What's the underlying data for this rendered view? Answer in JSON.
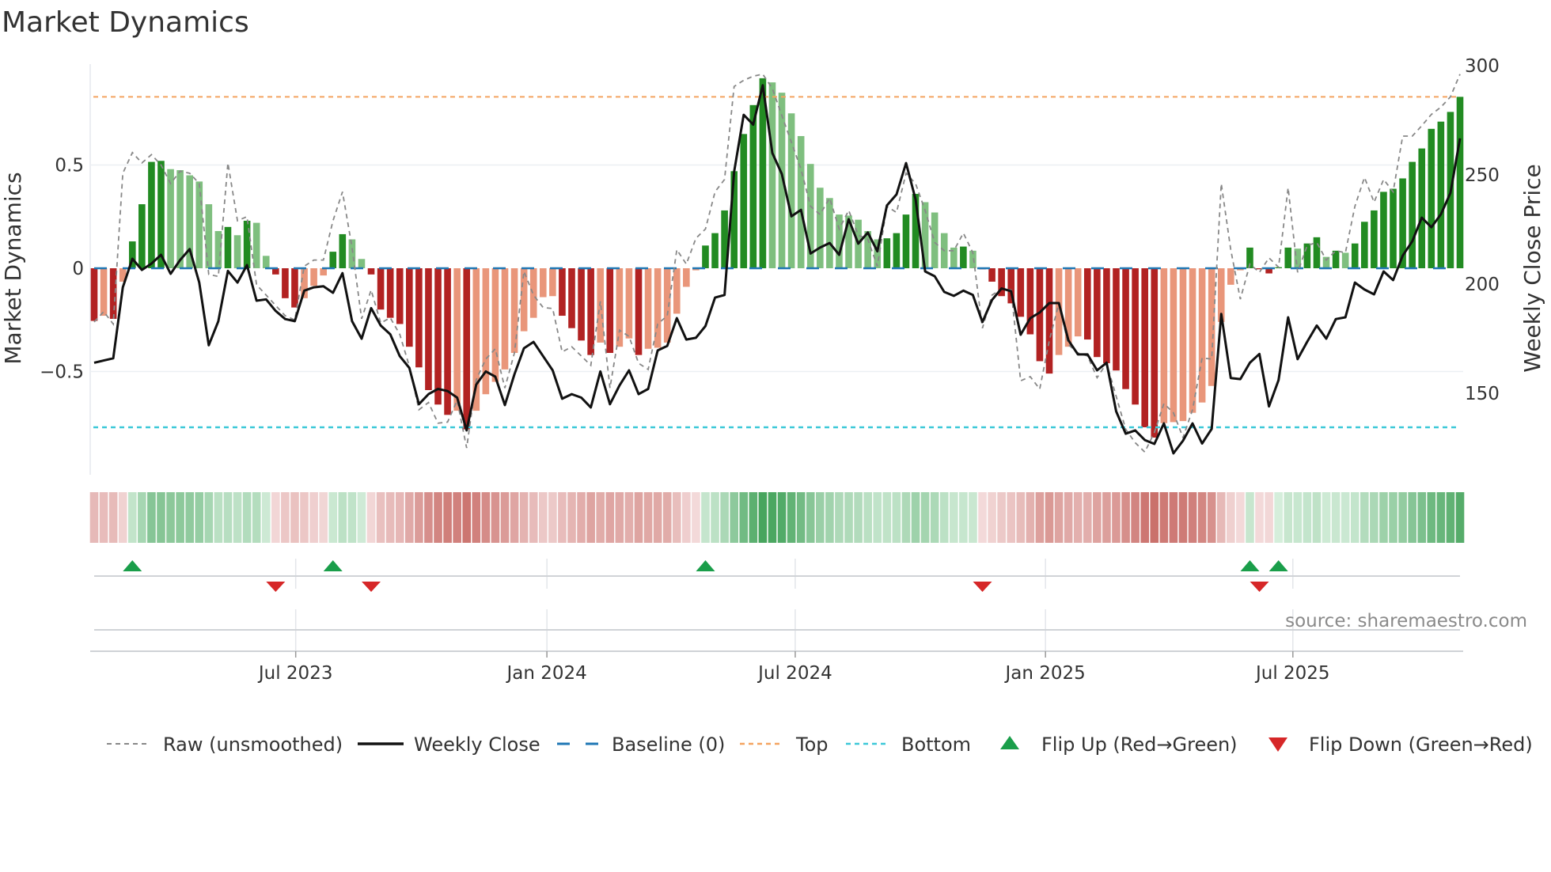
{
  "title": "Market Dynamics",
  "source": "source: sharemaestro.com",
  "colors": {
    "rising_green": "#228b22",
    "falling_green": "#7fbf7f",
    "falling_red": "#b22222",
    "rising_red": "#e9967a",
    "close": "#111111",
    "raw": "#888888",
    "baseline": "#1f77b4",
    "top": "#f4a460",
    "bottom": "#3cc8d8",
    "flip_up": "#1a9e4a",
    "flip_down": "#d62728"
  },
  "chart_data": {
    "type": "bar",
    "title": "Market Dynamics",
    "ylabel": "Market Dynamics",
    "y2label": "Weekly Close Price",
    "ylim": [
      -0.97,
      0.97
    ],
    "y2lim": [
      116,
      300
    ],
    "y_ticks": [
      {
        "value": 0.5,
        "label": "0.5"
      },
      {
        "value": 0,
        "label": "0"
      },
      {
        "value": -0.5,
        "label": "−0.5"
      }
    ],
    "y2_ticks": [
      {
        "value": 300,
        "label": "300"
      },
      {
        "value": 250,
        "label": "250"
      },
      {
        "value": 200,
        "label": "200"
      },
      {
        "value": 150,
        "label": "150"
      }
    ],
    "x_unit": "week index",
    "x_ticks": [
      {
        "index": 21.1,
        "label": "Jul 2023"
      },
      {
        "index": 47.4,
        "label": "Jan 2024"
      },
      {
        "index": 73.4,
        "label": "Jul 2024"
      },
      {
        "index": 99.6,
        "label": "Jan 2025"
      },
      {
        "index": 125.5,
        "label": "Jul 2025"
      }
    ],
    "grid": true,
    "legend_position": "bottom",
    "thresholds": {
      "baseline": 0,
      "top": 0.83,
      "bottom": -0.77
    },
    "series": [
      {
        "name": "Market Dynamics",
        "type": "bar",
        "values": [
          -0.255,
          -0.23,
          -0.245,
          -0.065,
          0.13,
          0.31,
          0.515,
          0.52,
          0.48,
          0.475,
          0.45,
          0.42,
          0.31,
          0.18,
          0.2,
          0.16,
          0.23,
          0.22,
          0.06,
          -0.03,
          -0.145,
          -0.19,
          -0.145,
          -0.085,
          -0.035,
          0.08,
          0.165,
          0.14,
          0.045,
          -0.03,
          -0.2,
          -0.24,
          -0.27,
          -0.38,
          -0.48,
          -0.59,
          -0.66,
          -0.71,
          -0.69,
          -0.78,
          -0.69,
          -0.61,
          -0.55,
          -0.49,
          -0.41,
          -0.305,
          -0.24,
          -0.14,
          -0.135,
          -0.23,
          -0.29,
          -0.35,
          -0.42,
          -0.36,
          -0.41,
          -0.38,
          -0.34,
          -0.42,
          -0.39,
          -0.385,
          -0.36,
          -0.22,
          -0.09,
          -0.01,
          0.11,
          0.17,
          0.28,
          0.47,
          0.65,
          0.79,
          0.92,
          0.9,
          0.85,
          0.75,
          0.64,
          0.505,
          0.39,
          0.34,
          0.26,
          0.255,
          0.235,
          0.18,
          0.14,
          0.145,
          0.17,
          0.26,
          0.36,
          0.32,
          0.27,
          0.17,
          0.1,
          0.105,
          0.085,
          -0.005,
          -0.065,
          -0.135,
          -0.17,
          -0.235,
          -0.32,
          -0.45,
          -0.51,
          -0.42,
          -0.38,
          -0.33,
          -0.345,
          -0.43,
          -0.46,
          -0.495,
          -0.585,
          -0.66,
          -0.77,
          -0.82,
          -0.75,
          -0.745,
          -0.74,
          -0.7,
          -0.65,
          -0.57,
          -0.26,
          -0.08,
          -0.01,
          0.1,
          -0.005,
          -0.025,
          0.005,
          0.1,
          0.095,
          0.12,
          0.15,
          0.055,
          0.085,
          0.075,
          0.12,
          0.225,
          0.28,
          0.37,
          0.385,
          0.435,
          0.515,
          0.58,
          0.675,
          0.71,
          0.757,
          0.83
        ]
      },
      {
        "name": "Raw (unsmoothed)",
        "type": "line",
        "values": [
          -0.26,
          -0.21,
          -0.27,
          0.46,
          0.56,
          0.51,
          0.55,
          0.5,
          0.41,
          0.47,
          0.46,
          0.41,
          -0.03,
          -0.04,
          0.51,
          0.23,
          0.25,
          -0.08,
          -0.13,
          -0.18,
          -0.23,
          -0.25,
          0.01,
          0.04,
          0.04,
          0.23,
          0.37,
          0.1,
          -0.245,
          -0.105,
          -0.265,
          -0.24,
          -0.32,
          -0.475,
          -0.685,
          -0.65,
          -0.75,
          -0.745,
          -0.64,
          -0.87,
          -0.54,
          -0.44,
          -0.39,
          -0.58,
          -0.41,
          -0.015,
          -0.13,
          -0.19,
          -0.195,
          -0.405,
          -0.38,
          -0.425,
          -0.47,
          -0.16,
          -0.58,
          -0.3,
          -0.33,
          -0.46,
          -0.49,
          -0.27,
          -0.23,
          0.09,
          0.02,
          0.145,
          0.19,
          0.37,
          0.43,
          0.88,
          0.91,
          0.93,
          0.94,
          0.87,
          0.74,
          0.61,
          0.48,
          0.3,
          0.26,
          0.34,
          0.19,
          0.28,
          0.16,
          0.14,
          0.01,
          0.3,
          0.27,
          0.46,
          0.41,
          0.28,
          0.125,
          0.085,
          0.085,
          0.17,
          0.075,
          -0.29,
          -0.13,
          -0.1,
          -0.105,
          -0.545,
          -0.525,
          -0.585,
          -0.35,
          -0.17,
          -0.37,
          -0.41,
          -0.425,
          -0.53,
          -0.46,
          -0.62,
          -0.78,
          -0.845,
          -0.89,
          -0.795,
          -0.655,
          -0.7,
          -0.82,
          -0.685,
          -0.435,
          -0.44,
          0.41,
          0.09,
          -0.15,
          0.02,
          -0.02,
          0.05,
          0.005,
          0.39,
          -0.02,
          0.11,
          0.125,
          0.04,
          0.085,
          0.075,
          0.3,
          0.44,
          0.32,
          0.43,
          0.37,
          0.64,
          0.64,
          0.69,
          0.745,
          0.78,
          0.83,
          0.94
        ]
      },
      {
        "name": "Weekly Close",
        "type": "line",
        "axis": "right",
        "values": [
          164,
          165,
          166,
          198.5,
          211.6,
          206.5,
          209.4,
          213.4,
          204.7,
          211,
          216,
          200.7,
          172,
          183,
          206,
          200.7,
          208.7,
          192.4,
          193,
          187.7,
          184,
          183,
          197,
          198.5,
          199,
          196,
          205,
          183,
          175,
          189,
          181,
          177,
          167,
          161.6,
          145,
          149.6,
          152,
          151,
          148,
          133,
          154,
          160,
          157.6,
          144.6,
          158.7,
          170.6,
          173.5,
          167,
          160.5,
          147.5,
          149.6,
          148,
          143.5,
          160,
          145,
          153.6,
          160.5,
          149.6,
          152,
          169.6,
          171.7,
          184.4,
          174.6,
          175.4,
          180.8,
          193.8,
          195,
          251.4,
          277.5,
          273,
          291,
          260,
          250.4,
          231,
          234,
          214,
          216.7,
          218.8,
          213.4,
          229.7,
          218.5,
          223.6,
          215,
          236,
          241,
          255.4,
          238.8,
          205.8,
          203.6,
          196.4,
          194.6,
          197,
          195,
          182.6,
          192.7,
          198,
          196.7,
          176.8,
          184.4,
          187,
          191.3,
          191.3,
          174.3,
          167.8,
          167.8,
          160.5,
          164,
          141.7,
          131.5,
          133,
          128.6,
          126.8,
          136.2,
          122.5,
          128.3,
          136.2,
          127,
          133.7,
          186.3,
          157,
          156.5,
          164,
          168,
          144,
          156,
          184.8,
          165.6,
          173.6,
          181,
          175,
          184,
          184.8,
          200.7,
          197.5,
          195.3,
          205.8,
          201.8,
          213,
          219.6,
          230.4,
          226,
          232,
          241.7,
          266.7
        ]
      }
    ],
    "flip_up_indices": [
      5,
      26,
      65,
      122,
      125
    ],
    "flip_down_indices": [
      20,
      30,
      94,
      123
    ],
    "legend": [
      {
        "key": "raw",
        "label": "Raw (unsmoothed)"
      },
      {
        "key": "close",
        "label": "Weekly Close"
      },
      {
        "key": "baseline",
        "label": "Baseline (0)"
      },
      {
        "key": "top",
        "label": "Top"
      },
      {
        "key": "bottom",
        "label": "Bottom"
      },
      {
        "key": "flip_up",
        "label": "Flip Up (Red→Green)"
      },
      {
        "key": "flip_down",
        "label": "Flip Down (Green→Red)"
      }
    ]
  }
}
